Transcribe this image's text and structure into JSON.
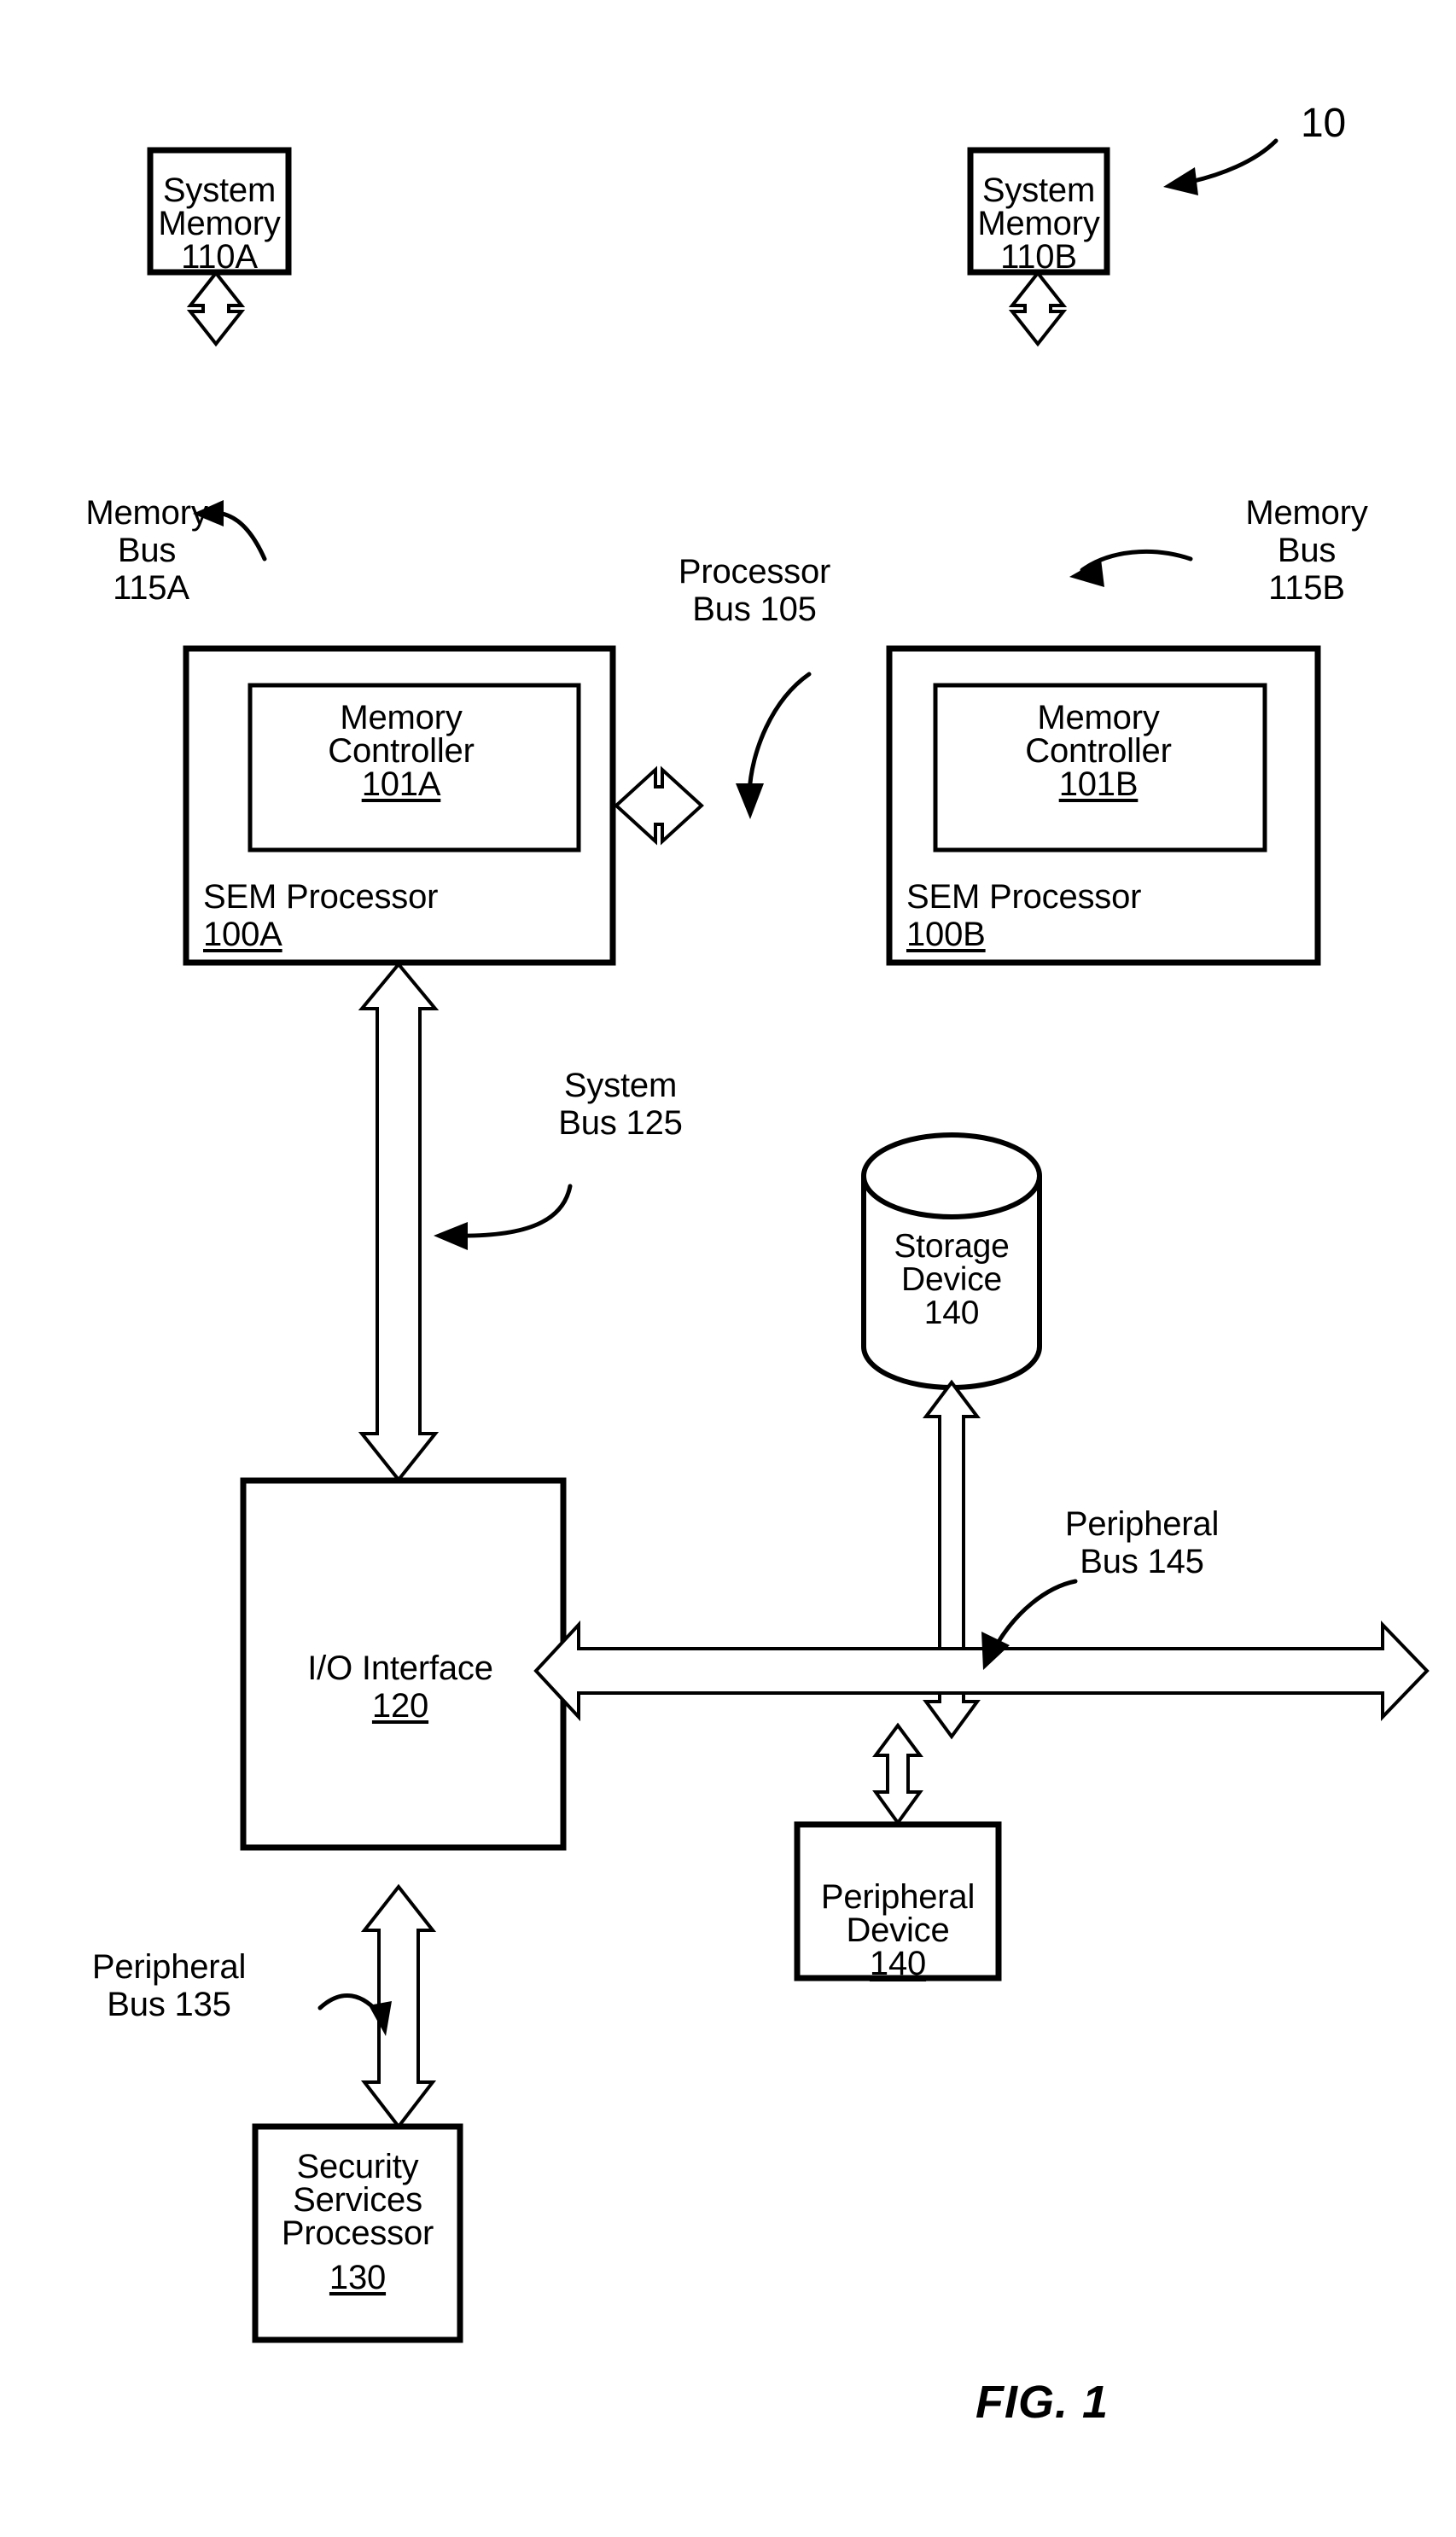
{
  "figure": {
    "caption": "FIG. 1",
    "system_reference_number": "10"
  },
  "blocks": [
    {
      "id": "system-memory-a",
      "lines": [
        "System",
        "Memory"
      ],
      "ref": "110A",
      "ref_underlined": true,
      "shape": "rect"
    },
    {
      "id": "system-memory-b",
      "lines": [
        "System",
        "Memory"
      ],
      "ref": "110B",
      "ref_underlined": true,
      "shape": "rect"
    },
    {
      "id": "memory-controller-a",
      "lines": [
        "Memory",
        "Controller"
      ],
      "ref": "101A",
      "ref_underlined": true,
      "shape": "rect"
    },
    {
      "id": "memory-controller-b",
      "lines": [
        "Memory",
        "Controller"
      ],
      "ref": "101B",
      "ref_underlined": true,
      "shape": "rect"
    },
    {
      "id": "sem-processor-a",
      "lines": [
        "SEM Processor"
      ],
      "ref": "100A",
      "ref_underlined": true,
      "shape": "rect"
    },
    {
      "id": "sem-processor-b",
      "lines": [
        "SEM Processor"
      ],
      "ref": "100B",
      "ref_underlined": true,
      "shape": "rect"
    },
    {
      "id": "io-interface",
      "lines": [
        "I/O Interface"
      ],
      "ref": "120",
      "ref_underlined": true,
      "shape": "rect"
    },
    {
      "id": "storage-device",
      "lines": [
        "Storage",
        "Device"
      ],
      "ref": "140",
      "ref_underlined": false,
      "shape": "cylinder"
    },
    {
      "id": "peripheral-device",
      "lines": [
        "Peripheral",
        "Device"
      ],
      "ref": "140",
      "ref_underlined": true,
      "shape": "rect"
    },
    {
      "id": "security-services-processor",
      "lines": [
        "Security",
        "Services",
        "Processor"
      ],
      "ref": "130",
      "ref_underlined": true,
      "shape": "rect"
    }
  ],
  "bus_labels": [
    {
      "id": "memory-bus-a",
      "lines": [
        "Memory",
        "Bus",
        "115A"
      ]
    },
    {
      "id": "memory-bus-b",
      "lines": [
        "Memory",
        "Bus",
        "115B"
      ]
    },
    {
      "id": "processor-bus",
      "lines": [
        "Processor",
        "Bus 105"
      ]
    },
    {
      "id": "system-bus",
      "lines": [
        "System",
        "Bus 125"
      ]
    },
    {
      "id": "peripheral-bus-145",
      "lines": [
        "Peripheral",
        "Bus 145"
      ]
    },
    {
      "id": "peripheral-bus-135",
      "lines": [
        "Peripheral",
        "Bus 135"
      ]
    }
  ],
  "text": {
    "system_memory_a_l1": "System",
    "system_memory_a_l2": "Memory",
    "system_memory_a_ref": "110A",
    "system_memory_b_l1": "System",
    "system_memory_b_l2": "Memory",
    "system_memory_b_ref": "110B",
    "memory_controller_a_l1": "Memory",
    "memory_controller_a_l2": "Controller",
    "memory_controller_a_ref": "101A",
    "memory_controller_b_l1": "Memory",
    "memory_controller_b_l2": "Controller",
    "memory_controller_b_ref": "101B",
    "sem_processor_a_l1": "SEM Processor",
    "sem_processor_a_ref": "100A",
    "sem_processor_b_l1": "SEM Processor",
    "sem_processor_b_ref": "100B",
    "io_interface_l1": "I/O Interface",
    "io_interface_ref": "120",
    "storage_device_l1": "Storage",
    "storage_device_l2": "Device",
    "storage_device_ref": "140",
    "peripheral_device_l1": "Peripheral",
    "peripheral_device_l2": "Device",
    "peripheral_device_ref": "140",
    "security_processor_l1": "Security",
    "security_processor_l2": "Services",
    "security_processor_l3": "Processor",
    "security_processor_ref": "130",
    "memory_bus_a_l1": "Memory",
    "memory_bus_a_l2": "Bus",
    "memory_bus_a_l3": "115A",
    "memory_bus_b_l1": "Memory",
    "memory_bus_b_l2": "Bus",
    "memory_bus_b_l3": "115B",
    "processor_bus_l1": "Processor",
    "processor_bus_l2": "Bus 105",
    "system_bus_l1": "System",
    "system_bus_l2": "Bus 125",
    "peripheral_bus_145_l1": "Peripheral",
    "peripheral_bus_145_l2": "Bus 145",
    "peripheral_bus_135_l1": "Peripheral",
    "peripheral_bus_135_l2": "Bus 135",
    "fig_caption": "FIG. 1",
    "top_ref": "10"
  },
  "colors": {
    "ink": "#000000",
    "paper": "#ffffff"
  }
}
